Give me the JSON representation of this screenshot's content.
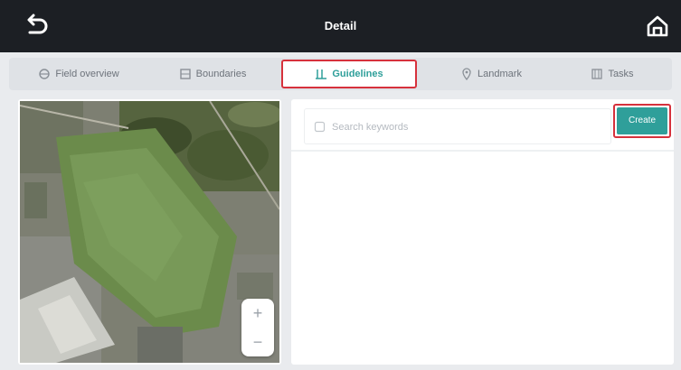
{
  "header": {
    "title": "Detail",
    "back_icon": "undo-arrow-icon",
    "home_icon": "home-icon"
  },
  "tabs": [
    {
      "label": "Field overview",
      "icon": "field-icon",
      "active": false
    },
    {
      "label": "Boundaries",
      "icon": "boundary-icon",
      "active": false
    },
    {
      "label": "Guidelines",
      "icon": "guideline-icon",
      "active": true
    },
    {
      "label": "Landmark",
      "icon": "pin-icon",
      "active": false
    },
    {
      "label": "Tasks",
      "icon": "tasks-icon",
      "active": false
    }
  ],
  "map": {
    "zoom_in": "+",
    "zoom_out": "−"
  },
  "search": {
    "placeholder": "Search keywords",
    "value": ""
  },
  "create_label": "Create",
  "colors": {
    "accent": "#2f9f9a",
    "highlight": "#d6313c",
    "titlebar": "#1c1f24"
  }
}
